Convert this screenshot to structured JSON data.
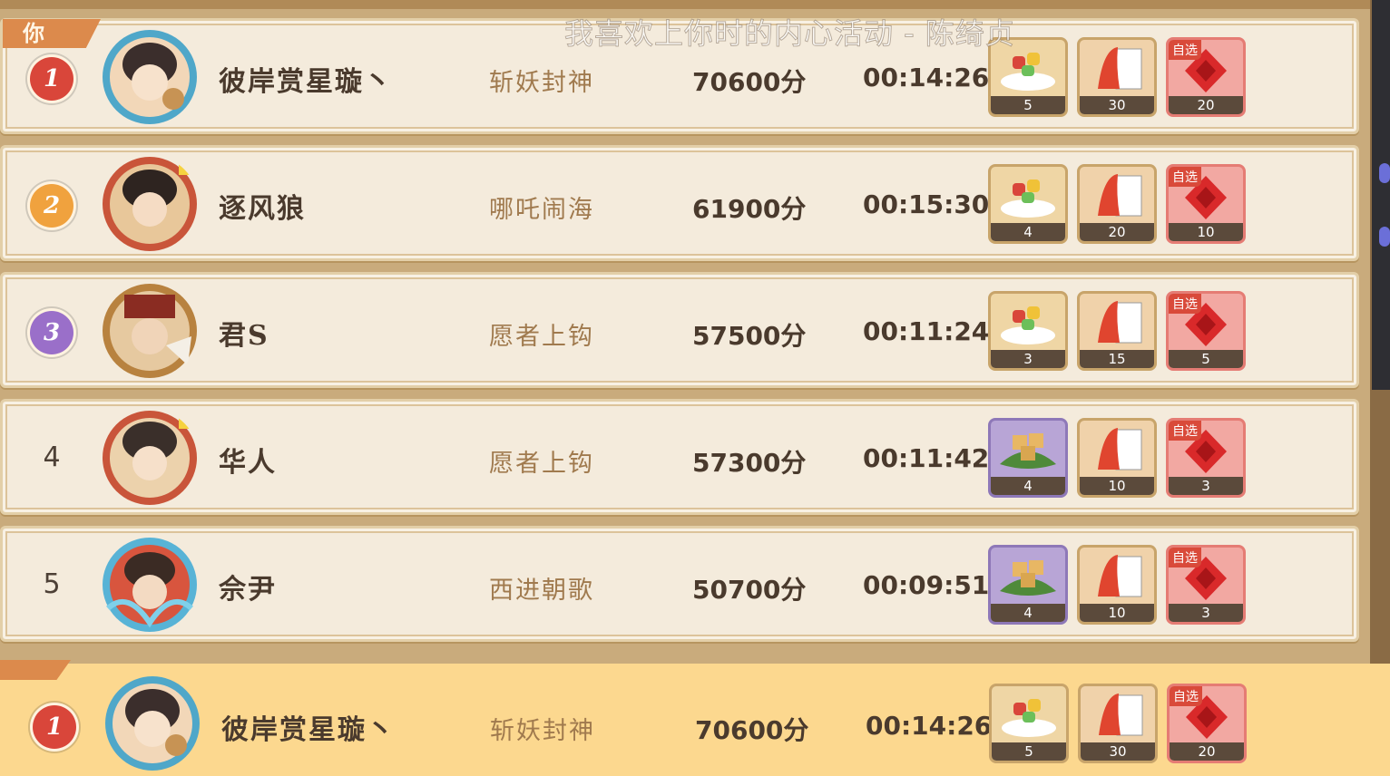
{
  "header": {
    "you_label": "你",
    "watermark": "我喜欢上你时的内心活动 - 陈绮贞"
  },
  "rows": [
    {
      "rank": "1",
      "name": "彼岸赏星璇丶",
      "level": "斩妖封神",
      "score": "70600分",
      "time": "00:14:26",
      "rewards": [
        {
          "type": "dish",
          "count": "5"
        },
        {
          "type": "card",
          "count": "30"
        },
        {
          "type": "choice",
          "tag": "自选",
          "count": "20"
        }
      ]
    },
    {
      "rank": "2",
      "name": "逐风狼",
      "level": "哪吒闹海",
      "score": "61900分",
      "time": "00:15:30",
      "rewards": [
        {
          "type": "dish",
          "count": "4"
        },
        {
          "type": "card",
          "count": "20"
        },
        {
          "type": "choice",
          "tag": "自选",
          "count": "10"
        }
      ]
    },
    {
      "rank": "3",
      "name": "君S",
      "level": "愿者上钩",
      "score": "57500分",
      "time": "00:11:24",
      "rewards": [
        {
          "type": "dish",
          "count": "3"
        },
        {
          "type": "card",
          "count": "15"
        },
        {
          "type": "choice",
          "tag": "自选",
          "count": "5"
        }
      ]
    },
    {
      "rank": "4",
      "name": "华人",
      "level": "愿者上钩",
      "score": "57300分",
      "time": "00:11:42",
      "rewards": [
        {
          "type": "cake",
          "count": "4"
        },
        {
          "type": "card",
          "count": "10"
        },
        {
          "type": "choice",
          "tag": "自选",
          "count": "3"
        }
      ]
    },
    {
      "rank": "5",
      "name": "佘尹",
      "level": "西进朝歌",
      "score": "50700分",
      "time": "00:09:51",
      "rewards": [
        {
          "type": "cake",
          "count": "4"
        },
        {
          "type": "card",
          "count": "10"
        },
        {
          "type": "choice",
          "tag": "自选",
          "count": "3"
        }
      ]
    }
  ],
  "my_row": {
    "rank": "1",
    "name": "彼岸赏星璇丶",
    "level": "斩妖封神",
    "score": "70600分",
    "time": "00:14:26",
    "rewards": [
      {
        "type": "dish",
        "count": "5"
      },
      {
        "type": "card",
        "count": "30"
      },
      {
        "type": "choice",
        "tag": "自选",
        "count": "20"
      }
    ]
  },
  "colors": {
    "medal_1": "#d9463a",
    "medal_2": "#f0a23e",
    "medal_3": "#9a6fc9",
    "highlight": "#fcd88f"
  }
}
